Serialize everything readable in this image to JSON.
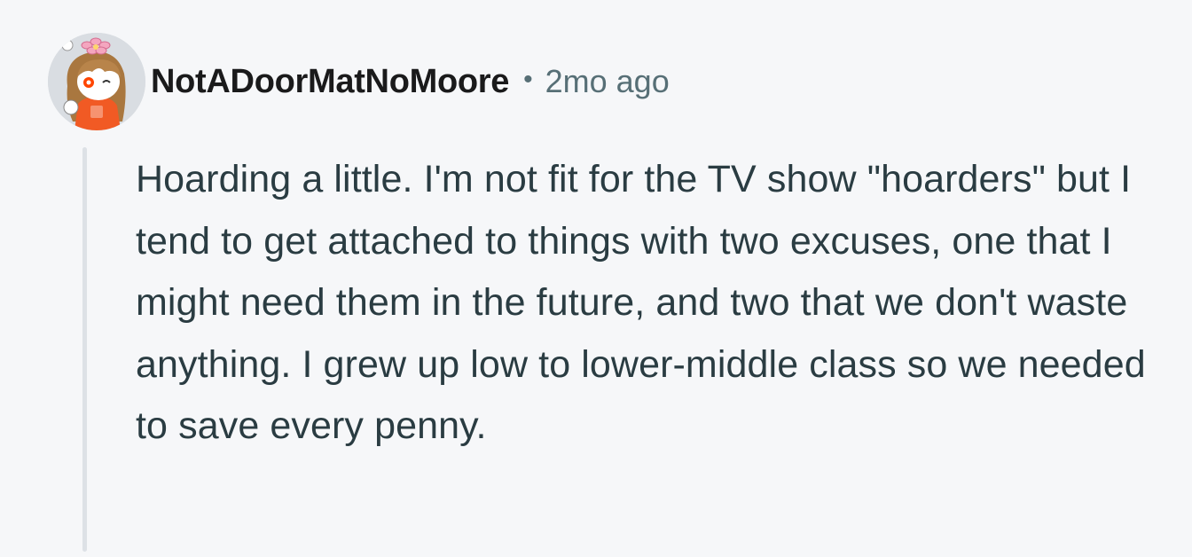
{
  "comment": {
    "author": "NotADoorMatNoMoore",
    "separator": "•",
    "time_ago": "2mo ago",
    "body": "Hoarding a little. I'm not fit for the TV show \"hoarders\" but I tend to get attached to things with two excuses, one that I might need them in the future, and two that we don't waste anything. I grew up low to lower-middle class so we needed to save every penny."
  },
  "colors": {
    "background": "#f6f7f9",
    "username": "#1a1a1b",
    "meta": "#576f76",
    "body_text": "#2a3c42",
    "thread_line": "#dde1e6"
  },
  "icons": {
    "avatar": "snoo-avatar-icon"
  }
}
